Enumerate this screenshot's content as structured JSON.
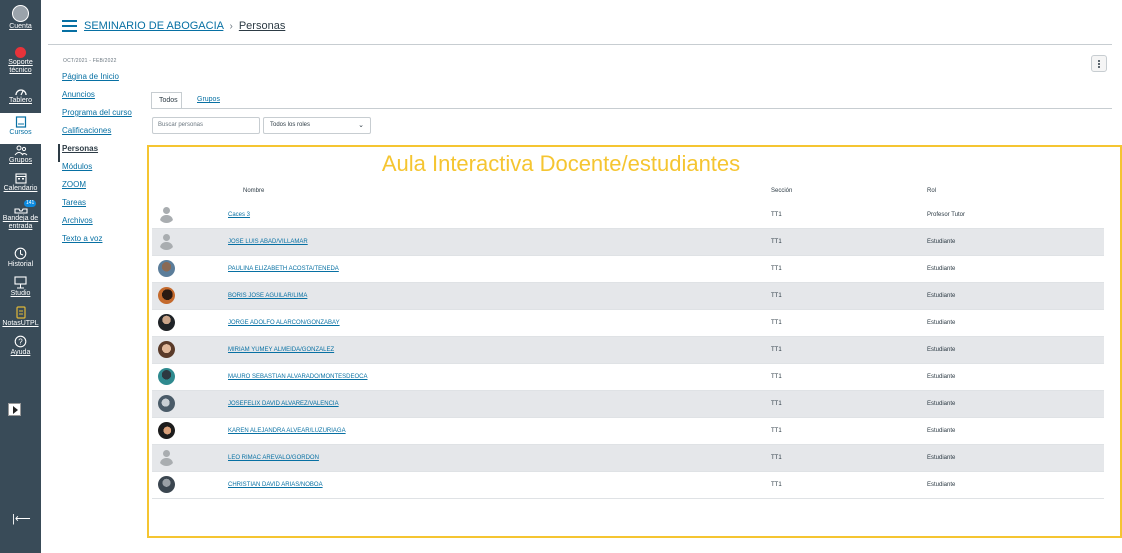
{
  "global_nav": [
    {
      "key": "account",
      "label": "Cuenta"
    },
    {
      "key": "support",
      "label_lines": [
        "Soporte",
        "técnico"
      ]
    },
    {
      "key": "dashboard",
      "label": "Tablero"
    },
    {
      "key": "courses",
      "label": "Cursos"
    },
    {
      "key": "groups",
      "label": "Grupos"
    },
    {
      "key": "calendar",
      "label": "Calendario"
    },
    {
      "key": "inbox",
      "label_lines": [
        "Bandeja de",
        "entrada"
      ],
      "badge": "141"
    },
    {
      "key": "history",
      "label": "Historial"
    },
    {
      "key": "studio",
      "label": "Studio"
    },
    {
      "key": "notas",
      "label": "NotasUTPL"
    },
    {
      "key": "help",
      "label": "Ayuda"
    }
  ],
  "breadcrumb": {
    "course": "SEMINARIO DE ABOGACIA",
    "separator": "›",
    "current": "Personas"
  },
  "course_nav": {
    "term": "OCT/2021 - FEB/2022",
    "items": [
      "Página de Inicio",
      "Anuncios",
      "Programa del curso",
      "Calificaciones",
      "Personas",
      "Módulos",
      "ZOOM",
      "Tareas",
      "Archivos",
      "Texto a voz"
    ],
    "active_index": 4
  },
  "tabs": {
    "active": "Todos",
    "other": "Grupos"
  },
  "filters": {
    "search_placeholder": "Buscar personas",
    "roles_selected": "Todos los roles"
  },
  "annotation": {
    "title": "Aula Interactiva Docente/estudiantes",
    "color": "#f5c531"
  },
  "table": {
    "headers": {
      "name": "Nombre",
      "section": "Sección",
      "role": "Rol"
    },
    "rows": [
      {
        "name": "Caces 3",
        "section": "TT1",
        "role": "Profesor Tutor",
        "avatar": "default"
      },
      {
        "name": "JOSE LUIS ABAD/VILLAMAR",
        "section": "TT1",
        "role": "Estudiante",
        "avatar": "default"
      },
      {
        "name": "PAULINA ELIZABETH ACOSTA/TENEDA",
        "section": "TT1",
        "role": "Estudiante",
        "avatar": "photo"
      },
      {
        "name": "BORIS JOSE AGUILAR/LIMA",
        "section": "TT1",
        "role": "Estudiante",
        "avatar": "photo"
      },
      {
        "name": "JORGE ADOLFO ALARCON/GONZABAY",
        "section": "TT1",
        "role": "Estudiante",
        "avatar": "photo"
      },
      {
        "name": "MIRIAM YUMEY ALMEIDA/GONZALEZ",
        "section": "TT1",
        "role": "Estudiante",
        "avatar": "photo"
      },
      {
        "name": "MAURO SEBASTIAN ALVARADO/MONTESDEOCA",
        "section": "TT1",
        "role": "Estudiante",
        "avatar": "photo"
      },
      {
        "name": "JOSEFELIX DAVID ALVAREZ/VALENCIA",
        "section": "TT1",
        "role": "Estudiante",
        "avatar": "photo"
      },
      {
        "name": "KAREN ALEJANDRA ALVEAR/LUZURIAGA",
        "section": "TT1",
        "role": "Estudiante",
        "avatar": "photo"
      },
      {
        "name": "LEO RIMAC AREVALO/GORDON",
        "section": "TT1",
        "role": "Estudiante",
        "avatar": "default"
      },
      {
        "name": "CHRISTIAN DAVID ARIAS/NOBOA",
        "section": "TT1",
        "role": "Estudiante",
        "avatar": "photo"
      }
    ]
  },
  "colors": {
    "nav_bg": "#394b58",
    "link": "#0770a3",
    "alt_row": "#e5e7ea"
  }
}
